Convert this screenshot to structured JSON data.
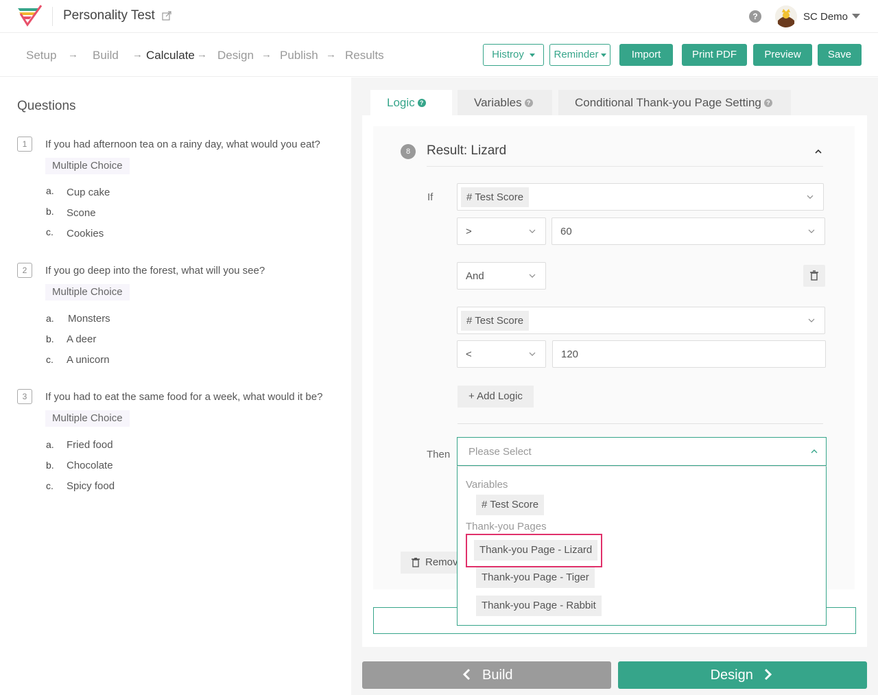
{
  "header": {
    "app_title": "Personality Test",
    "user_name": "SC Demo"
  },
  "steps": [
    "Setup",
    "Build",
    "Calculate",
    "Design",
    "Publish",
    "Results"
  ],
  "active_step": "Calculate",
  "toolbar": {
    "history_label": "Histroy",
    "reminder_label": "Reminder",
    "import_label": "Import",
    "print_pdf_label": "Print PDF",
    "preview_label": "Preview",
    "save_label": "Save"
  },
  "questions": {
    "heading": "Questions",
    "items": [
      {
        "num": "1",
        "text": "If you had afternoon tea on a rainy day, what would you eat?",
        "type": "Multiple Choice",
        "options": [
          {
            "letter": "a.",
            "text": "Cup cake"
          },
          {
            "letter": "b.",
            "text": "Scone"
          },
          {
            "letter": "c.",
            "text": "Cookies"
          }
        ]
      },
      {
        "num": "2",
        "text": "If you go deep into the forest, what will you see?",
        "type": "Multiple Choice",
        "options": [
          {
            "letter": "a.",
            "text": "Monsters"
          },
          {
            "letter": "b.",
            "text": "A deer"
          },
          {
            "letter": "c.",
            "text": "A unicorn"
          }
        ]
      },
      {
        "num": "3",
        "text": "If you had to eat the same food for a week, what would it be?",
        "type": "Multiple Choice",
        "options": [
          {
            "letter": "a.",
            "text": "Fried food"
          },
          {
            "letter": "b.",
            "text": "Chocolate"
          },
          {
            "letter": "c.",
            "text": "Spicy food"
          }
        ]
      }
    ]
  },
  "tabs": [
    {
      "label": "Logic",
      "active": true
    },
    {
      "label": "Variables",
      "active": false
    },
    {
      "label": "Conditional Thank-you Page Setting",
      "active": false
    }
  ],
  "result": {
    "number": "8",
    "title": "Result: Lizard",
    "if_label": "If",
    "then_label": "Then",
    "condition1": {
      "variable": "# Test Score",
      "operator": ">",
      "value": "60"
    },
    "joiner": "And",
    "condition2": {
      "variable": "# Test Score",
      "operator": "<",
      "value": "120"
    },
    "add_logic_label": "+ Add Logic",
    "remove_label": "Remove",
    "then_placeholder": "Please Select"
  },
  "dropdown": {
    "variables_group": "Variables",
    "variable_options": [
      "# Test Score"
    ],
    "pages_group": "Thank-you Pages",
    "page_options": [
      "Thank-you Page - Lizard",
      "Thank-you Page - Tiger",
      "Thank-you Page - Rabbit"
    ]
  },
  "nav": {
    "back_label": "Build",
    "next_label": "Design"
  },
  "colors": {
    "accent": "#36a58a",
    "highlight": "#e0306a",
    "back_button": "#9b9b9b"
  }
}
